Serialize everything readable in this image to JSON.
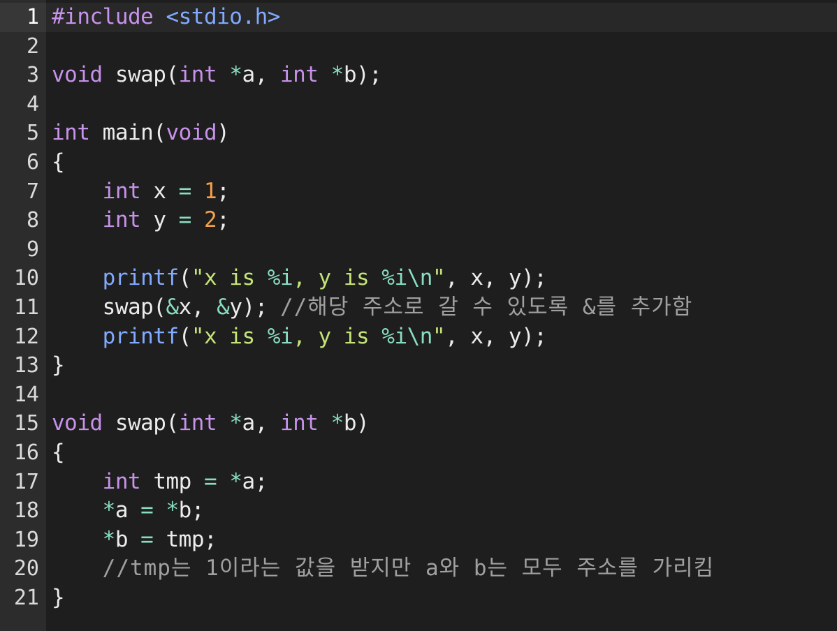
{
  "editor": {
    "active_line": 1,
    "lines": [
      {
        "n": "1",
        "tokens": [
          [
            "pre",
            "#include"
          ],
          [
            "plain",
            " "
          ],
          [
            "inc",
            "<stdio.h>"
          ]
        ]
      },
      {
        "n": "2",
        "tokens": []
      },
      {
        "n": "3",
        "tokens": [
          [
            "kw",
            "void"
          ],
          [
            "plain",
            " swap("
          ],
          [
            "type",
            "int"
          ],
          [
            "plain",
            " "
          ],
          [
            "op",
            "*"
          ],
          [
            "plain",
            "a, "
          ],
          [
            "type",
            "int"
          ],
          [
            "plain",
            " "
          ],
          [
            "op",
            "*"
          ],
          [
            "plain",
            "b);"
          ]
        ]
      },
      {
        "n": "4",
        "tokens": []
      },
      {
        "n": "5",
        "tokens": [
          [
            "type",
            "int"
          ],
          [
            "plain",
            " main("
          ],
          [
            "kw",
            "void"
          ],
          [
            "plain",
            ")"
          ]
        ]
      },
      {
        "n": "6",
        "tokens": [
          [
            "plain",
            "{"
          ]
        ]
      },
      {
        "n": "7",
        "tokens": [
          [
            "plain",
            "    "
          ],
          [
            "type",
            "int"
          ],
          [
            "plain",
            " x "
          ],
          [
            "op",
            "="
          ],
          [
            "plain",
            " "
          ],
          [
            "num",
            "1"
          ],
          [
            "plain",
            ";"
          ]
        ]
      },
      {
        "n": "8",
        "tokens": [
          [
            "plain",
            "    "
          ],
          [
            "type",
            "int"
          ],
          [
            "plain",
            " y "
          ],
          [
            "op",
            "="
          ],
          [
            "plain",
            " "
          ],
          [
            "num",
            "2"
          ],
          [
            "plain",
            ";"
          ]
        ]
      },
      {
        "n": "9",
        "tokens": []
      },
      {
        "n": "10",
        "tokens": [
          [
            "plain",
            "    "
          ],
          [
            "fn",
            "printf"
          ],
          [
            "plain",
            "("
          ],
          [
            "strk",
            "\"x is "
          ],
          [
            "op",
            "%i"
          ],
          [
            "strk",
            ", y is "
          ],
          [
            "op",
            "%i\\n"
          ],
          [
            "strk",
            "\""
          ],
          [
            "plain",
            ", x, y);"
          ]
        ]
      },
      {
        "n": "11",
        "tokens": [
          [
            "plain",
            "    swap("
          ],
          [
            "op",
            "&"
          ],
          [
            "plain",
            "x, "
          ],
          [
            "op",
            "&"
          ],
          [
            "plain",
            "y); "
          ],
          [
            "cmt",
            "//해당 주소로 갈 수 있도록 &를 추가함"
          ]
        ]
      },
      {
        "n": "12",
        "tokens": [
          [
            "plain",
            "    "
          ],
          [
            "fn",
            "printf"
          ],
          [
            "plain",
            "("
          ],
          [
            "strk",
            "\"x is "
          ],
          [
            "op",
            "%i"
          ],
          [
            "strk",
            ", y is "
          ],
          [
            "op",
            "%i\\n"
          ],
          [
            "strk",
            "\""
          ],
          [
            "plain",
            ", x, y);"
          ]
        ]
      },
      {
        "n": "13",
        "tokens": [
          [
            "plain",
            "}"
          ]
        ]
      },
      {
        "n": "14",
        "tokens": []
      },
      {
        "n": "15",
        "tokens": [
          [
            "kw",
            "void"
          ],
          [
            "plain",
            " swap("
          ],
          [
            "type",
            "int"
          ],
          [
            "plain",
            " "
          ],
          [
            "op",
            "*"
          ],
          [
            "plain",
            "a, "
          ],
          [
            "type",
            "int"
          ],
          [
            "plain",
            " "
          ],
          [
            "op",
            "*"
          ],
          [
            "plain",
            "b)"
          ]
        ]
      },
      {
        "n": "16",
        "tokens": [
          [
            "plain",
            "{"
          ]
        ]
      },
      {
        "n": "17",
        "tokens": [
          [
            "plain",
            "    "
          ],
          [
            "type",
            "int"
          ],
          [
            "plain",
            " tmp "
          ],
          [
            "op",
            "="
          ],
          [
            "plain",
            " "
          ],
          [
            "op",
            "*"
          ],
          [
            "plain",
            "a;"
          ]
        ]
      },
      {
        "n": "18",
        "tokens": [
          [
            "plain",
            "    "
          ],
          [
            "op",
            "*"
          ],
          [
            "plain",
            "a "
          ],
          [
            "op",
            "="
          ],
          [
            "plain",
            " "
          ],
          [
            "op",
            "*"
          ],
          [
            "plain",
            "b;"
          ]
        ]
      },
      {
        "n": "19",
        "tokens": [
          [
            "plain",
            "    "
          ],
          [
            "op",
            "*"
          ],
          [
            "plain",
            "b "
          ],
          [
            "op",
            "="
          ],
          [
            "plain",
            " tmp;"
          ]
        ]
      },
      {
        "n": "20",
        "tokens": [
          [
            "plain",
            "    "
          ],
          [
            "cmt",
            "//tmp는 1이라는 값을 받지만 a와 b는 모두 주소를 가리킴"
          ]
        ]
      },
      {
        "n": "21",
        "tokens": [
          [
            "plain",
            "}"
          ]
        ]
      }
    ]
  },
  "colors": {
    "background": "#1e1e1e",
    "gutter": "#2c2c2c",
    "keyword": "#c792ea",
    "function": "#82aaff",
    "string": "#c5e478",
    "number": "#f5a04a",
    "operator": "#89ddc2",
    "comment": "#a0a0a0"
  }
}
